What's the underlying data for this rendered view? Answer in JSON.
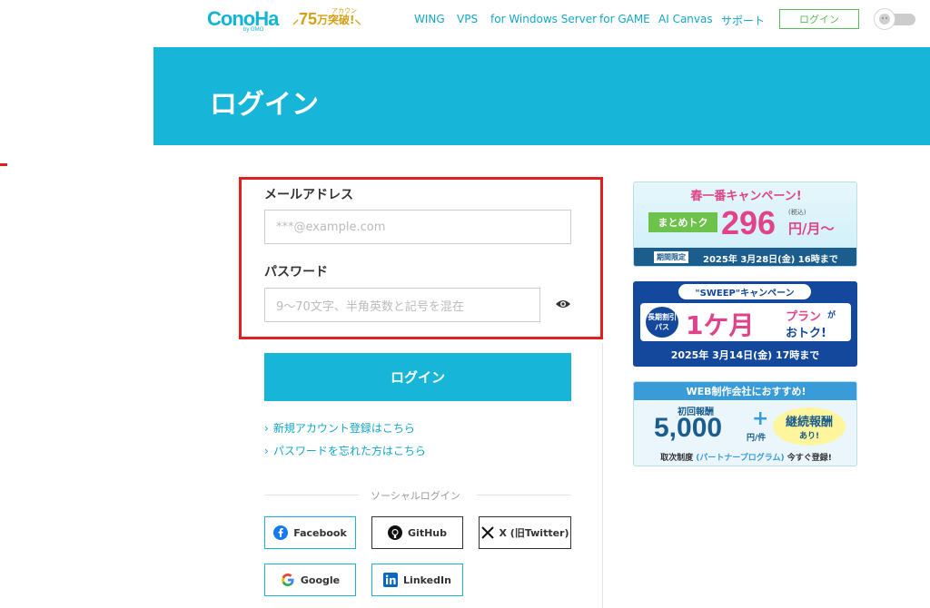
{
  "header": {
    "logo": "ConoHa",
    "logo_sub": "by GMO",
    "badge": {
      "number": "75",
      "unit": "万",
      "text": "突破!",
      "small": "アカウント"
    },
    "nav": [
      "WING",
      "VPS",
      "for Windows Server",
      "for GAME",
      "AI Canvas",
      "サポート"
    ],
    "login_button": "ログイン"
  },
  "page": {
    "title": "ログイン"
  },
  "form": {
    "email_label": "メールアドレス",
    "email_placeholder": "***@example.com",
    "password_label": "パスワード",
    "password_placeholder": "9〜70文字、半角英数と記号を混在",
    "submit": "ログイン",
    "links": [
      "新規アカウント登録はこちら",
      "パスワードを忘れた方はこちら"
    ],
    "social_label": "ソーシャルログイン",
    "social": [
      "Facebook",
      "GitHub",
      "X (旧Twitter)",
      "Google",
      "LinkedIn"
    ]
  },
  "ads": {
    "spring": {
      "title": "春一番キャンペーン!",
      "tag": "まとめトク",
      "price": "296",
      "unit": "円/月〜",
      "tax": "(税込)",
      "limit": "期間限定",
      "date": "2025年 3月28日(金) 16時まで"
    },
    "sweep": {
      "title": "\"SWEEP\"キャンペーン",
      "tag1": "長期割引",
      "tag2": "パス",
      "big": "1ケ月",
      "plan": "プラン",
      "ga": "が",
      "otoku": "おトク!",
      "date": "2025年 3月14日(金) 17時まで"
    },
    "web": {
      "title": "WEB制作会社におすすめ!",
      "first": "初回報酬",
      "amount": "5,000",
      "per": "円/件",
      "plus": "+",
      "cont": "継続報酬",
      "ari": "あり!",
      "footer_a": "取次制度",
      "footer_b": "(パートナープログラム)",
      "footer_c": "今すぐ登録!"
    }
  },
  "colors": {
    "brand": "#17b6d9",
    "highlight": "#e02020",
    "green": "#5cb85c"
  }
}
